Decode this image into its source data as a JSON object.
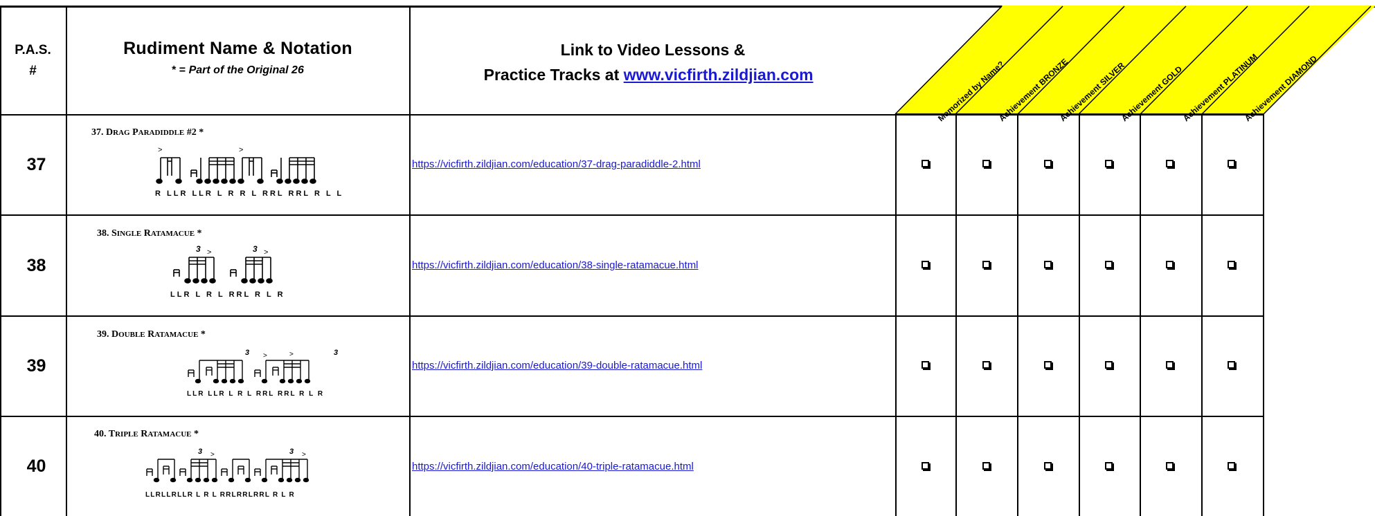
{
  "header": {
    "pas_line1": "P.A.S.",
    "pas_line2": "#",
    "name_title": "Rudiment Name & Notation",
    "name_sub_star": "* =",
    "name_sub_italic": "Part of the Original 26",
    "link_line1": "Link to Video Lessons &",
    "link_line2_prefix": "Practice Tracks at",
    "link_url": "www.vicfirth.zildjian.com",
    "achievements": [
      "Memorized by Name?",
      "Achievement BRONZE",
      "Achievement SILVER",
      "Achievement GOLD",
      "Achievement PLATINUM",
      "Achievement DIAMOND"
    ],
    "header_fill": "#ffff00"
  },
  "rows": [
    {
      "pas": "37",
      "title_num": "37.",
      "title_word1_cap": "D",
      "title_word1_rest": "RAG",
      "title_word2_cap": "P",
      "title_word2_rest": "ARADIDDLE",
      "title_suffix": "#2 *",
      "sticking": "R LLR LLR L R R L RRL RRL R L L",
      "url": "https://vicfirth.zildjian.com/education/37-drag-paradiddle-2.html"
    },
    {
      "pas": "38",
      "title_num": "38.",
      "title_word1_cap": "S",
      "title_word1_rest": "INGLE",
      "title_word2_cap": "R",
      "title_word2_rest": "ATAMACUE",
      "title_suffix": "*",
      "sticking": "LLR L R L RRL R L R",
      "url": "https://vicfirth.zildjian.com/education/38-single-ratamacue.html"
    },
    {
      "pas": "39",
      "title_num": "39.",
      "title_word1_cap": "D",
      "title_word1_rest": "OUBLE",
      "title_word2_cap": "R",
      "title_word2_rest": "ATAMACUE",
      "title_suffix": "*",
      "sticking": "LLR LLR L R L RRL RRL R L R",
      "url": "https://vicfirth.zildjian.com/education/39-double-ratamacue.html"
    },
    {
      "pas": "40",
      "title_num": "40.",
      "title_word1_cap": "T",
      "title_word1_rest": "RIPLE",
      "title_word2_cap": "R",
      "title_word2_rest": "ATAMACUE",
      "title_suffix": "*",
      "sticking": "LLRLLRLLR L R L RRLRRLRRL R L R",
      "url": "https://vicfirth.zildjian.com/education/40-triple-ratamacue.html"
    }
  ],
  "checkbox_glyph": "❑"
}
